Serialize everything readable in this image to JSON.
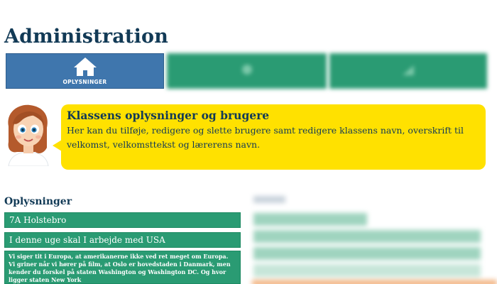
{
  "header": {
    "title": "Administration"
  },
  "tabs": [
    {
      "label": "OPLYSNINGER",
      "icon": "home-icon",
      "active": true
    },
    {
      "label": "",
      "icon": "blurred-icon",
      "active": false
    },
    {
      "label": "",
      "icon": "blurred-icon",
      "active": false
    }
  ],
  "info_box": {
    "title": "Klassens oplysninger og brugere",
    "text": "Her kan du tilføje, redigere og slette brugere samt redigere klassens navn, overskrift til velkomst, velkomsttekst og lærerens navn."
  },
  "oplysninger": {
    "section_title": "Oplysninger",
    "class_name": "7A Holstebro",
    "headline": "I denne uge skal I arbejde med USA",
    "welcome_text": "Vi siger tit i Europa, at amerikanerne ikke ved ret meget om Europa. Vi griner når vi hører på film, at Oslo er hovedstaden i Danmark, men kender du forskel på staten Washington og Washington DC. Og hvor ligger staten New York"
  },
  "colors": {
    "tab_active": "#3f76ad",
    "tab_inactive": "#2a9b73",
    "bubble": "#ffe100",
    "field": "#2a9b73",
    "heading": "#123a56"
  }
}
